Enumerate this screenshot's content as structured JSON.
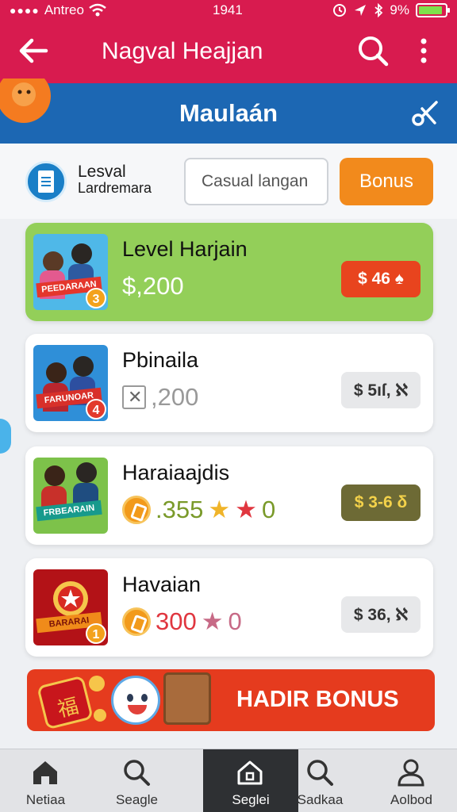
{
  "status_bar": {
    "carrier": "Antreo",
    "time": "1941",
    "battery_text": "9%",
    "battery_level": 0.9
  },
  "app_bar": {
    "title": "Nagval Heajjan"
  },
  "header": {
    "title": "Maulaán"
  },
  "controls": {
    "level_label_line1": "Lesval",
    "level_label_line2": "Lardremara",
    "filter_placeholder": "Casual langan",
    "bonus_label": "Bonus"
  },
  "cards": [
    {
      "title": "Level Harjain",
      "amount": "$,200",
      "price": "$ 46 ♠",
      "badge": "3",
      "thumb_banner": "PEEDARAAN",
      "price_bg": "#e8441e",
      "price_color": "#ffffff"
    },
    {
      "title": "Pbinaila",
      "amount": ",200",
      "price": "$ 5ıſ, ℵ",
      "badge": "4",
      "thumb_banner": "FARUNOAR",
      "price_bg": "#e7e8ea",
      "price_color": "#333333"
    },
    {
      "title": "Haraiaajdis",
      "amount": ".355",
      "amount_suffix": "0",
      "price": "$ 3-6 δ",
      "badge": "",
      "thumb_banner": "FRBEARAIN",
      "price_bg": "#6d6a35",
      "price_color": "#f4d24a"
    },
    {
      "title": "Havaian",
      "amount": "300",
      "amount_suffix": "0",
      "price": "$ 36, ℵ",
      "badge": "1",
      "thumb_banner": "BARARAI",
      "price_bg": "#e7e8ea",
      "price_color": "#333333"
    }
  ],
  "promo": {
    "text": "HADIR BONUS"
  },
  "bottom_nav": [
    {
      "label": "Netiaa",
      "icon": "home-icon"
    },
    {
      "label": "Seagle",
      "icon": "search-icon"
    },
    {
      "label": "Seglei",
      "icon": "home-outline-icon",
      "active": true
    },
    {
      "label": "Sadkaa",
      "icon": "search-icon"
    },
    {
      "label": "Aolbod",
      "icon": "profile-icon"
    }
  ]
}
